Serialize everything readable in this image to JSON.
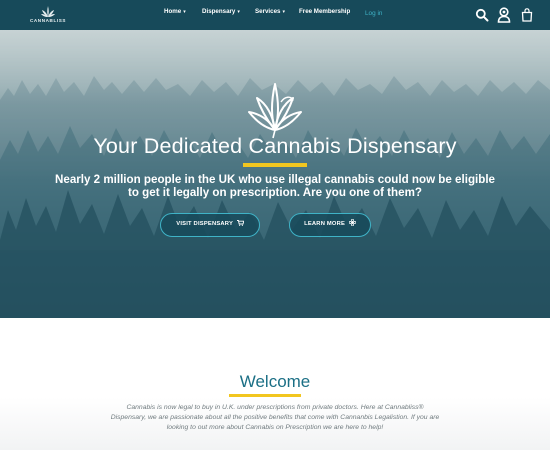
{
  "brand": {
    "logo_text": "CANNABLISS"
  },
  "nav": {
    "items": [
      {
        "label": "Home",
        "has_dropdown": true
      },
      {
        "label": "Dispensary",
        "has_dropdown": true
      },
      {
        "label": "Services",
        "has_dropdown": true
      },
      {
        "label": "Free Membership",
        "has_dropdown": false
      }
    ],
    "login_label": "Log in",
    "icons": [
      "search-icon",
      "account-icon",
      "cart-icon"
    ]
  },
  "hero": {
    "title": "Your Dedicated Cannabis Dispensary",
    "subtitle": "Nearly 2 million people in the UK who use illegal cannabis could now be eligible to get it legally on prescription. Are you one of them?",
    "buttons": [
      {
        "label": "VISIT DISPENSARY",
        "icon": "cart-icon"
      },
      {
        "label": "LEARN MORE",
        "icon": "flower-icon"
      }
    ]
  },
  "welcome": {
    "title": "Welcome",
    "body": "Cannabis is now legal to buy in U.K. under prescriptions from private doctors. Here at Cannabliss® Dispensary, we are passionate about all the positive benefits that come with Cannanbis Legalistion. If you are looking to out more about Cannabis on Prescription we are here to help!"
  },
  "colors": {
    "nav_bg": "#174a5a",
    "accent_teal": "#3fb3c7",
    "accent_yellow": "#f2c61f",
    "welcome_title": "#1b6f85"
  }
}
